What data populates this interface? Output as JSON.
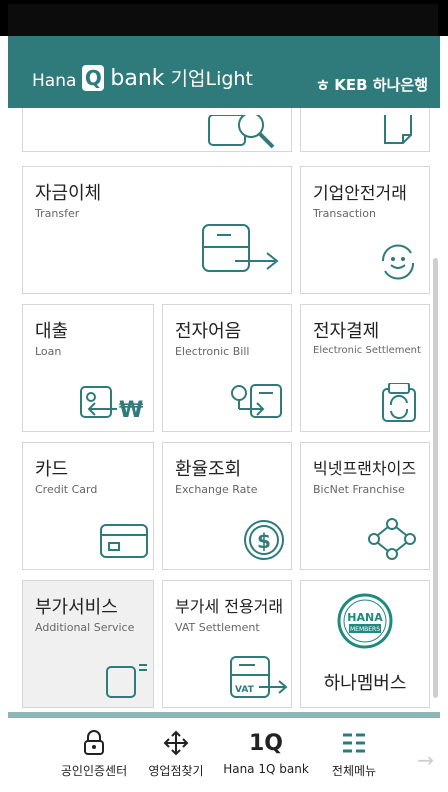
{
  "header": {
    "brand_hana": "Hana",
    "brand_q": "Q",
    "brand_bank": "bank",
    "brand_sub": "기업Light",
    "partner": "KEB 하나은행",
    "partner_logo": "ㅎ"
  },
  "tiles": [
    {
      "ko": "자금이체",
      "en": "Transfer"
    },
    {
      "ko": "기업안전거래",
      "en": "Transaction"
    },
    {
      "ko": "대출",
      "en": "Loan"
    },
    {
      "ko": "전자어음",
      "en": "Electronic Bill"
    },
    {
      "ko": "전자결제",
      "en": "Electronic Settlement"
    },
    {
      "ko": "카드",
      "en": "Credit Card"
    },
    {
      "ko": "환율조회",
      "en": "Exchange Rate"
    },
    {
      "ko": "빅넷프랜차이즈",
      "en": "BicNet Franchise"
    },
    {
      "ko": "부가서비스",
      "en": "Additional Service"
    },
    {
      "ko": "부가세 전용거래",
      "en": "VAT Settlement"
    },
    {
      "ko": "하나멤버스",
      "en": ""
    }
  ],
  "hana_members_badge": {
    "line1": "HANA",
    "line2": "MEMBERS"
  },
  "vat_label": "VAT",
  "won_symbol": "₩",
  "dollar_symbol": "$",
  "nav": [
    {
      "label": "공인인증센터",
      "icon": "lock-icon"
    },
    {
      "label": "영업점찾기",
      "icon": "move-icon"
    },
    {
      "label": "Hana 1Q bank",
      "icon": "1q-icon",
      "glyph": "1Q"
    },
    {
      "label": "전체메뉴",
      "icon": "menu-icon"
    }
  ]
}
